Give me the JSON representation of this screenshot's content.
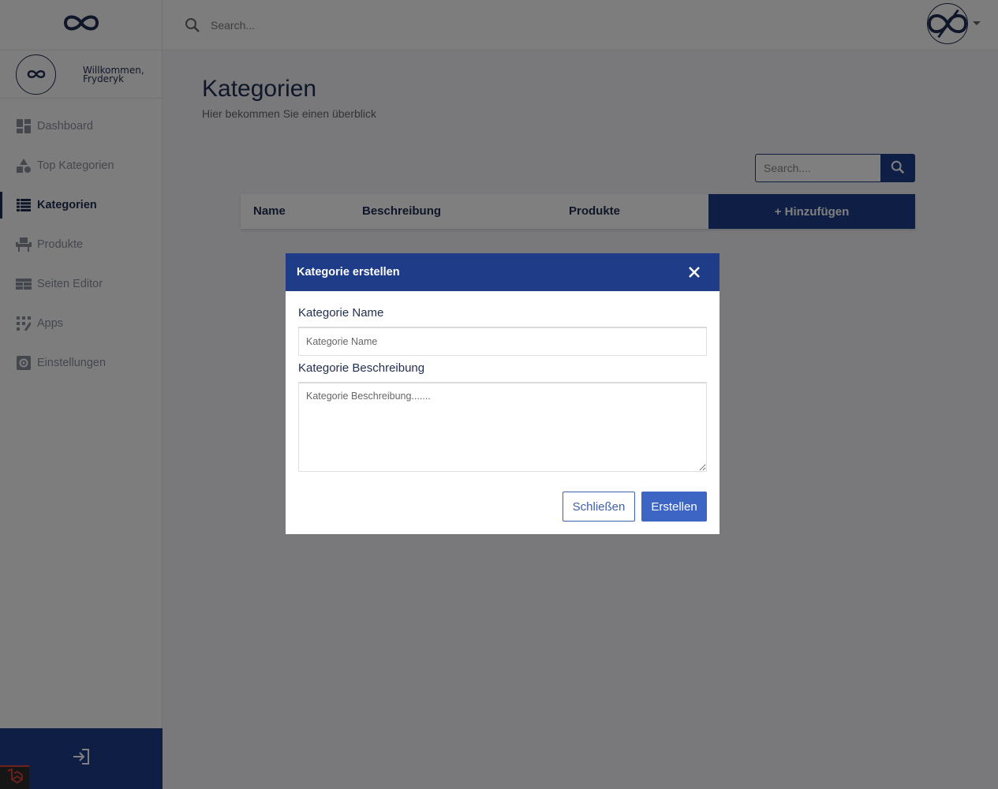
{
  "colors": {
    "primary": "#1f3c88",
    "dark_navy": "#1f2d4e",
    "button_blue": "#3d66c4",
    "sidebar_bg": "#fbfbfd",
    "page_bg": "#f2f3f8"
  },
  "brand": {
    "logo_icon": "infinity-icon"
  },
  "user": {
    "welcome_line1": "Willkommen,",
    "welcome_line2": "Fryderyk"
  },
  "sidebar": {
    "items": [
      {
        "label": "Dashboard",
        "icon": "dashboard-icon",
        "active": false
      },
      {
        "label": "Top Kategorien",
        "icon": "shapes-icon",
        "active": false
      },
      {
        "label": "Kategorien",
        "icon": "list-icon",
        "active": true
      },
      {
        "label": "Produkte",
        "icon": "chair-icon",
        "active": false
      },
      {
        "label": "Seiten Editor",
        "icon": "layout-icon",
        "active": false
      },
      {
        "label": "Apps",
        "icon": "apps-icon",
        "active": false
      },
      {
        "label": "Einstellungen",
        "icon": "gear-icon",
        "active": false
      }
    ],
    "logout_icon": "logout-icon"
  },
  "topbar": {
    "search_placeholder": "Search..."
  },
  "main": {
    "title": "Kategorien",
    "subtitle": "Hier bekommen Sie einen überblick",
    "table_search_placeholder": "Search....",
    "columns": [
      "Name",
      "Beschreibung",
      "Produkte"
    ],
    "add_button": "+ Hinzufügen"
  },
  "modal": {
    "title": "Kategorie erstellen",
    "name_label": "Kategorie Name",
    "name_placeholder": "Kategorie Name",
    "desc_label": "Kategorie Beschreibung",
    "desc_placeholder": "Kategorie Beschreibung.......",
    "close_button": "Schließen",
    "create_button": "Erstellen"
  }
}
